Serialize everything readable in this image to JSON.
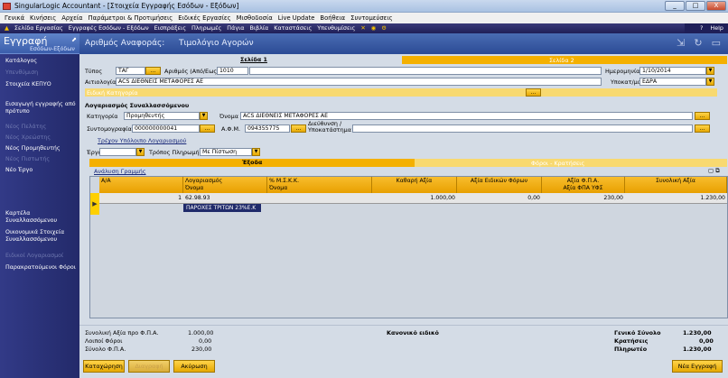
{
  "window": {
    "title": "SingularLogic Accountant - [Στοιχεία Εγγραφής Εσόδων - Εξόδων]",
    "min": "_",
    "max": "□",
    "close": "X"
  },
  "menu": [
    "Γενικά",
    "Κινήσεις",
    "Αρχεία",
    "Παράμετροι & Προτιμήσεις",
    "Ειδικές Εργασίες",
    "Μισθοδοσία",
    "Live Update",
    "Βοήθεια",
    "Συντομεύσεις"
  ],
  "nav": [
    "Σελίδα Εργασίας",
    "Εγγραφές Εσόδων - Εξόδων",
    "Εισπράξεις",
    "Πληρωμές",
    "Πάγια",
    "Βιβλία",
    "Καταστάσεις",
    "Υπενθυμίσεις"
  ],
  "nav_help": "Help",
  "sidebar": {
    "title": "Εγγραφή",
    "subtitle": "Εσόδων-Εξόδων",
    "items": [
      "Κατάλογος",
      "Υπενθύμιση",
      "Στοιχεία ΚΕΠΥΟ",
      "Εισαγωγή εγγραφής από πρότυπο",
      "Νέος Πελάτης",
      "Νέος Χρεώστης",
      "Νέος Προμηθευτής",
      "Νέος Πιστωτής",
      "Νέο Έργο",
      "Καρτέλα Συναλλασσόμενου",
      "Οικονομικά Στοιχεία Συναλλασσόμενου",
      "Ειδικοί Λογαριασμοί",
      "Παρακρατούμενοι Φόροι"
    ]
  },
  "header": {
    "ref_label": "Αριθμός Αναφοράς:",
    "doc_type": "Τιμολόγιο Αγορών"
  },
  "tabs": {
    "page1": "Σελίδα 1",
    "page2": "Σελίδα 2"
  },
  "form": {
    "type_label": "Τύπος",
    "type_value": "ΤΑΓ",
    "number_label": "Αριθμός (Από/Εως)",
    "number_value": "1010",
    "date_label": "Ημερομηνία",
    "date_value": "1/10/2014",
    "reason_label": "Αιτιολογία",
    "reason_value": "ACS ΔΙΕΘΝΕΙΣ ΜΕΤΑΦΟΡΕΣ ΑΕ",
    "branch_label": "Υποκατ/μα",
    "branch_value": "ΕΔΡΑ",
    "special_label": "Ειδική Κατηγορία",
    "account_section": "Λογαριασμός Συναλλασσόμενου",
    "category_label": "Κατηγορία",
    "category_value": "Προμηθευτής",
    "name_label": "Όνομα",
    "name_value": "ACS ΔΙΕΘΝΕΙΣ ΜΕΤΑΦΟΡΕΣ ΑΕ",
    "counterparty_label": "Συντομογραφία",
    "counterparty_value": "000000000041",
    "afm_label": "Α.Φ.Μ.",
    "afm_value": "094355775",
    "address_label": "Διεύθυνση / Υποκατάστημα",
    "balance_link": "Τρέχον Υπόλοιπο Λογαριασμού",
    "project_label": "Έργο",
    "payment_label": "Τρόπος Πληρωμής",
    "payment_value": "Με Πίστωση"
  },
  "expenses": {
    "title": "Έξοδα",
    "vat_title": "Φόροι - Κρατήσεις",
    "analysis_link": "Ανάλυση Γραμμής"
  },
  "grid": {
    "headers": [
      {
        "l1": "Α/Α",
        "l2": ""
      },
      {
        "l1": "Λογαριασμός",
        "l2": "Όνομα"
      },
      {
        "l1": "% Μ.Σ.Κ.Κ.",
        "l2": "Όνομα"
      },
      {
        "l1": "Καθαρή Αξία",
        "l2": ""
      },
      {
        "l1": "Αξία Ειδικών Φόρων",
        "l2": ""
      },
      {
        "l1": "Αξία Φ.Π.Α.",
        "l2": "Αξία ΦΠΑ ΥΦΣ"
      },
      {
        "l1": "Συνολική Αξία",
        "l2": ""
      }
    ],
    "rows": [
      {
        "aa": "1",
        "account": "62.98.93",
        "net": "1.000,00",
        "special": "0,00",
        "vat": "230,00",
        "total": "1.230,00",
        "name": "ΠΑΡΟΧΕΣ ΤΡΙΤΩΝ 23%Ε.Κ"
      }
    ]
  },
  "totals": {
    "net_label": "Συνολική Αξία προ Φ.Π.Α.",
    "net_value": "1.000,00",
    "other_label": "Λοιποί Φόροι",
    "other_value": "0,00",
    "vat_label": "Σύνολο Φ.Π.Α.",
    "vat_value": "230,00",
    "mode": "Κανονικό ειδικό",
    "gen_label": "Γενικό Σύνολο",
    "gen_value": "1.230,00",
    "ret_label": "Κρατήσεις",
    "ret_value": "0,00",
    "pay_label": "Πληρωτέο",
    "pay_value": "1.230,00"
  },
  "buttons": {
    "save": "Καταχώρηση",
    "delete": "Διαγραφή",
    "cancel": "Ακύρωση",
    "new": "Νέα Εγγραφή"
  }
}
